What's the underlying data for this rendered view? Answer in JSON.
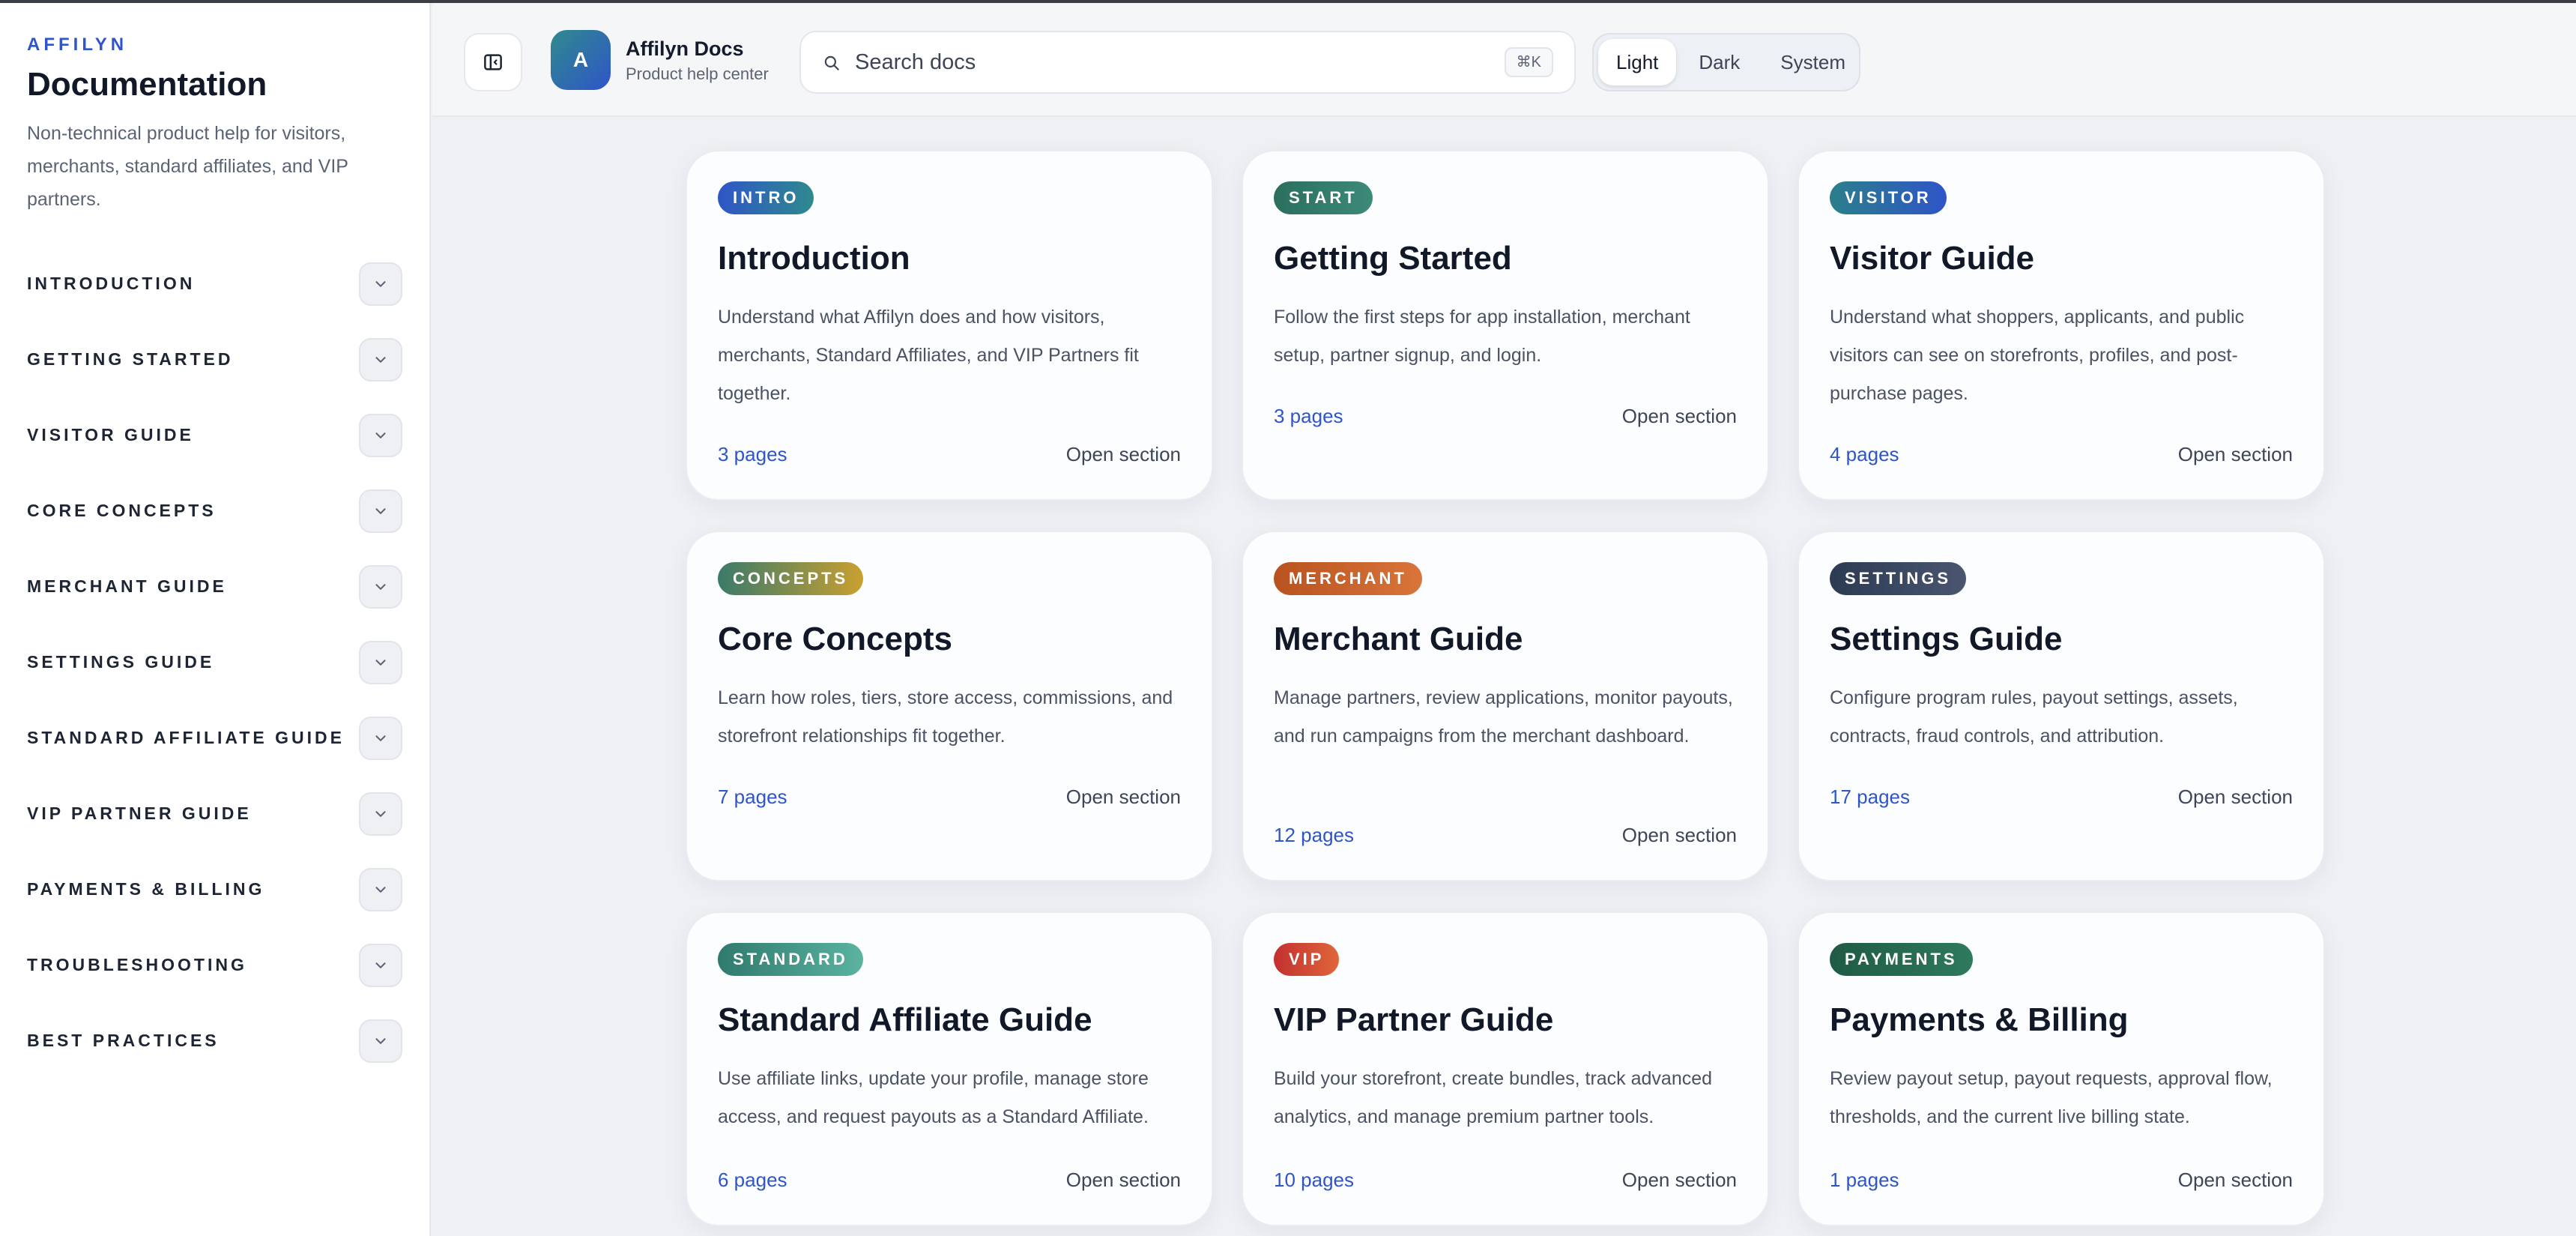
{
  "sidebar": {
    "brand": "AFFILYN",
    "title": "Documentation",
    "description": "Non-technical product help for visitors, merchants, standard affiliates, and VIP partners.",
    "items": [
      {
        "label": "INTRODUCTION"
      },
      {
        "label": "GETTING STARTED"
      },
      {
        "label": "VISITOR GUIDE"
      },
      {
        "label": "CORE CONCEPTS"
      },
      {
        "label": "MERCHANT GUIDE"
      },
      {
        "label": "SETTINGS GUIDE"
      },
      {
        "label": "STANDARD AFFILIATE GUIDE"
      },
      {
        "label": "VIP PARTNER GUIDE"
      },
      {
        "label": "PAYMENTS & BILLING"
      },
      {
        "label": "TROUBLESHOOTING"
      },
      {
        "label": "BEST PRACTICES"
      }
    ]
  },
  "header": {
    "avatar_letter": "A",
    "app_name": "Affilyn Docs",
    "app_sub": "Product help center",
    "search_placeholder": "Search docs",
    "search_shortcut": "⌘K",
    "theme_options": [
      "Light",
      "Dark",
      "System"
    ],
    "theme_selected": "Light"
  },
  "cards": [
    {
      "badge": "INTRO",
      "badge_color": "linear-gradient(90deg,#2f55c8,#2f8a8e)",
      "title": "Introduction",
      "desc": "Understand what Affilyn does and how visitors, merchants, Standard Affiliates, and VIP Partners fit together.",
      "pages": "3 pages",
      "open": "Open section"
    },
    {
      "badge": "START",
      "badge_color": "linear-gradient(90deg,#2b6e5e,#3d8a7a)",
      "title": "Getting Started",
      "desc": "Follow the first steps for app installation, merchant setup, partner signup, and login.",
      "pages": "3 pages",
      "open": "Open section"
    },
    {
      "badge": "VISITOR",
      "badge_color": "linear-gradient(90deg,#2a7f8a,#2f55c8)",
      "title": "Visitor Guide",
      "desc": "Understand what shoppers, applicants, and public visitors can see on storefronts, profiles, and post-purchase pages.",
      "pages": "4 pages",
      "open": "Open section"
    },
    {
      "badge": "CONCEPTS",
      "badge_color": "linear-gradient(90deg,#3b7a6a,#c9a030)",
      "title": "Core Concepts",
      "desc": "Learn how roles, tiers, store access, commissions, and storefront relationships fit together.",
      "pages": "7 pages",
      "open": "Open section"
    },
    {
      "badge": "MERCHANT",
      "badge_color": "linear-gradient(90deg,#b8531f,#d9743a)",
      "title": "Merchant Guide",
      "desc": "Manage partners, review applications, monitor payouts, and run campaigns from the merchant dashboard.",
      "pages": "12 pages",
      "open": "Open section"
    },
    {
      "badge": "SETTINGS",
      "badge_color": "linear-gradient(90deg,#2c3a52,#4a5670)",
      "title": "Settings Guide",
      "desc": "Configure program rules, payout settings, assets, contracts, fraud controls, and attribution.",
      "pages": "17 pages",
      "open": "Open section"
    },
    {
      "badge": "STANDARD",
      "badge_color": "linear-gradient(90deg,#2f7a6e,#5bb3a0)",
      "title": "Standard Affiliate Guide",
      "desc": "Use affiliate links, update your profile, manage store access, and request payouts as a Standard Affiliate.",
      "pages": "6 pages",
      "open": "Open section"
    },
    {
      "badge": "VIP",
      "badge_color": "linear-gradient(90deg,#c2302f,#e0663a)",
      "title": "VIP Partner Guide",
      "desc": "Build your storefront, create bundles, track advanced analytics, and manage premium partner tools.",
      "pages": "10 pages",
      "open": "Open section"
    },
    {
      "badge": "PAYMENTS",
      "badge_color": "linear-gradient(90deg,#1f5a44,#2f7a5e)",
      "title": "Payments & Billing",
      "desc": "Review payout setup, payout requests, approval flow, thresholds, and the current live billing state.",
      "pages": "1 pages",
      "open": "Open section"
    }
  ]
}
